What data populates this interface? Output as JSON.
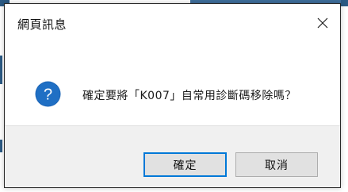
{
  "dialog": {
    "title": "網頁訊息",
    "message": "確定要將「K007」自常用診斷碼移除嗎？",
    "icon": "question-icon",
    "close_icon": "close-icon",
    "buttons": {
      "ok_label": "確定",
      "cancel_label": "取消"
    }
  },
  "colors": {
    "icon_blue": "#1c65b7",
    "focus_border": "#0078d7",
    "footer_bg": "#f0f0f0",
    "button_bg": "#e1e1e1"
  }
}
